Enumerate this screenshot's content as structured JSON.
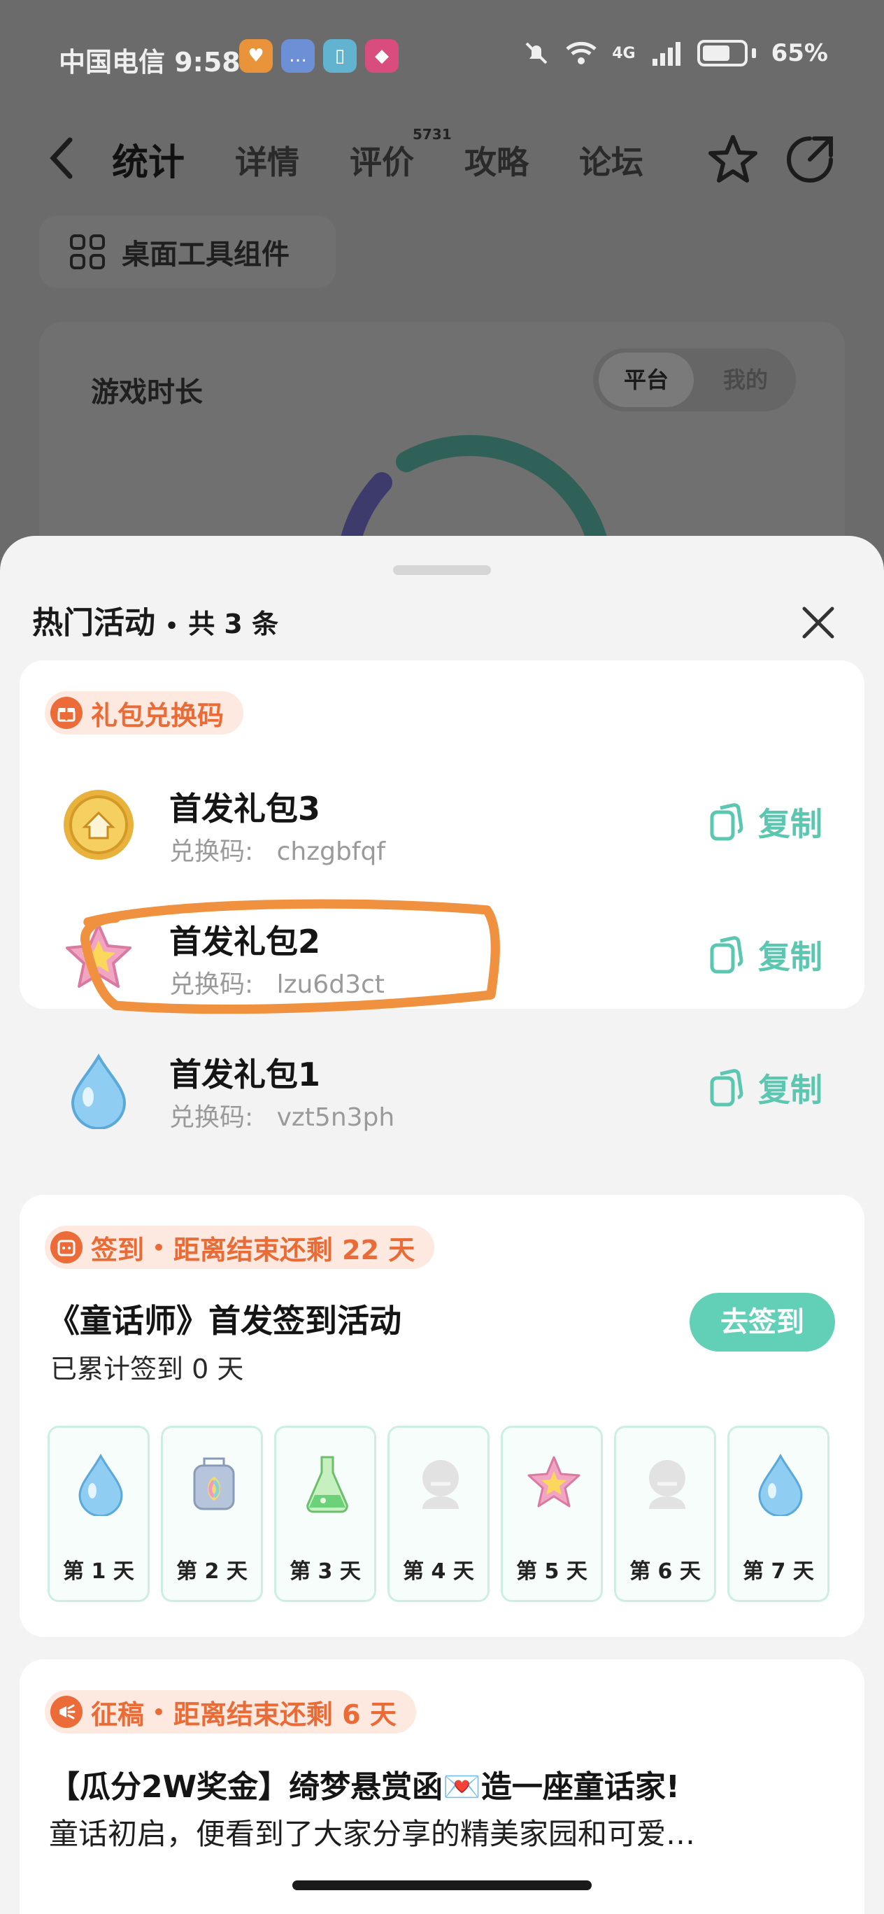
{
  "status_bar": {
    "carrier_time": "中国电信 9:58",
    "battery": "65%",
    "network": "4G"
  },
  "nav": {
    "tabs": [
      {
        "label": "统计"
      },
      {
        "label": "详情"
      },
      {
        "label": "评价"
      },
      {
        "label": "攻略"
      },
      {
        "label": "论坛"
      }
    ],
    "review_count": "5731"
  },
  "widget_chip": {
    "label": "桌面工具组件"
  },
  "stat_card": {
    "title": "游戏时长",
    "segments": [
      "平台",
      "我的"
    ]
  },
  "sheet": {
    "title": "热门活动",
    "count": "共 3 条"
  },
  "gift_section": {
    "tag": "礼包兑换码",
    "copy_label": "复制",
    "code_prefix": "兑换码:",
    "items": [
      {
        "name": "首发礼包3",
        "code": "chzgbfqf",
        "icon": "gold-coin-icon"
      },
      {
        "name": "首发礼包2",
        "code": "lzu6d3ct",
        "icon": "pink-star-icon"
      },
      {
        "name": "首发礼包1",
        "code": "vzt5n3ph",
        "icon": "water-drop-icon"
      }
    ]
  },
  "sign_section": {
    "tag": "签到",
    "tag_sep": "•",
    "remaining": "距离结束还剩 22 天",
    "title": "《童话师》首发签到活动",
    "subtitle": "已累计签到 0 天",
    "button": "去签到",
    "days": [
      {
        "label": "第 1 天",
        "icon": "water-drop-icon"
      },
      {
        "label": "第 2 天",
        "icon": "rainbow-bag-icon"
      },
      {
        "label": "第 3 天",
        "icon": "green-potion-icon"
      },
      {
        "label": "第 4 天",
        "icon": "locked-character-icon"
      },
      {
        "label": "第 5 天",
        "icon": "pink-star-icon"
      },
      {
        "label": "第 6 天",
        "icon": "locked-character-icon"
      },
      {
        "label": "第 7 天",
        "icon": "water-drop-icon"
      }
    ]
  },
  "contest_section": {
    "tag": "征稿",
    "tag_sep": "•",
    "remaining": "距离结束还剩 6 天",
    "title": "【瓜分2W奖金】绮梦悬赏函💌造一座童话家!",
    "body": "童话初启，便看到了大家分享的精美家园和可爱…"
  },
  "colors": {
    "accent_teal": "#5cc7b1",
    "tag_orange": "#ea6b36",
    "tag_bg": "#fde9e0",
    "highlight_orange": "#f0913f"
  }
}
